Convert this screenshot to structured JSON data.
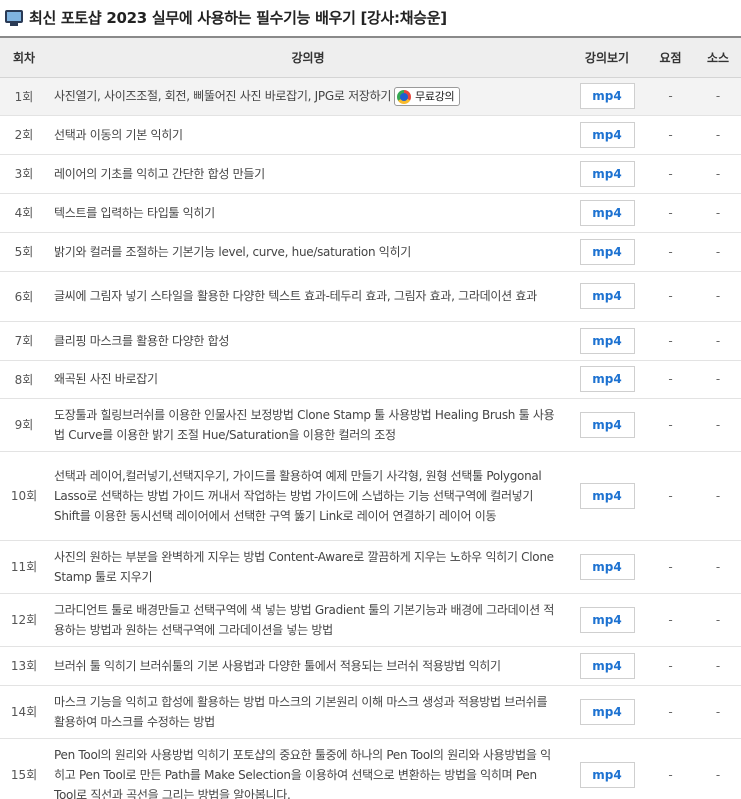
{
  "page": {
    "title": "최신 포토샵 2023 실무에 사용하는 필수기능 배우기 [강사:채승운]",
    "icon": "monitor-icon"
  },
  "table": {
    "headers": {
      "num": "회차",
      "title": "강의명",
      "view": "강의보기",
      "summary": "요점",
      "source": "소스"
    },
    "free_badge": "무료강의",
    "rows": [
      {
        "num": "1회",
        "title": "사진열기, 사이즈조절, 회전, 삐뚤어진 사진 바로잡기, JPG로 저장하기",
        "view": "mp4",
        "summary": "-",
        "source": "-",
        "free": true
      },
      {
        "num": "2회",
        "title": "선택과 이동의 기본 익히기",
        "view": "mp4",
        "summary": "-",
        "source": "-"
      },
      {
        "num": "3회",
        "title": "레이어의 기초를 익히고 간단한 합성 만들기",
        "view": "mp4",
        "summary": "-",
        "source": "-"
      },
      {
        "num": "4회",
        "title": "텍스트를 입력하는 타입툴 익히기",
        "view": "mp4",
        "summary": "-",
        "source": "-"
      },
      {
        "num": "5회",
        "title": "밝기와 컬러를 조절하는 기본기능 level, curve, hue/saturation 익히기",
        "view": "mp4",
        "summary": "-",
        "source": "-"
      },
      {
        "num": "6회",
        "title": "글씨에 그림자 넣기 스타일을 활용한 다양한 텍스트 효과-테두리 효과, 그림자 효과, 그라데이션 효과",
        "view": "mp4",
        "summary": "-",
        "source": "-"
      },
      {
        "num": "7회",
        "title": "클리핑 마스크를 활용한 다양한 합성",
        "view": "mp4",
        "summary": "-",
        "source": "-"
      },
      {
        "num": "8회",
        "title": "왜곡된 사진 바로잡기",
        "view": "mp4",
        "summary": "-",
        "source": "-"
      },
      {
        "num": "9회",
        "title": "도장툴과 힐링브러쉬를 이용한 인물사진 보정방법 Clone Stamp 툴 사용방법 Healing Brush 툴 사용법 Curve를 이용한 밝기 조절 Hue/Saturation을 이용한 컬러의 조정",
        "view": "mp4",
        "summary": "-",
        "source": "-"
      },
      {
        "num": "10회",
        "title": "선택과 레이어,컬러넣기,선택지우기, 가이드를 활용하여 예제 만들기 사각형, 원형 선택툴 Polygonal Lasso로 선택하는 방법 가이드 꺼내서 작업하는 방법 가이드에 스냅하는 기능 선택구역에 컬러넣기 Shift를 이용한 동시선택 레이어에서 선택한 구역 뚫기 Link로 레이어 연결하기 레이어 이동",
        "view": "mp4",
        "summary": "-",
        "source": "-"
      },
      {
        "num": "11회",
        "title": "사진의 원하는 부분을 완벽하게 지우는 방법 Content-Aware로 깔끔하게 지우는 노하우 익히기 Clone Stamp 툴로 지우기",
        "view": "mp4",
        "summary": "-",
        "source": "-"
      },
      {
        "num": "12회",
        "title": "그라디언트 툴로 배경만들고 선택구역에 색 넣는 방법 Gradient 툴의 기본기능과 배경에 그라데이션 적용하는 방법과 원하는 선택구역에 그라데이션을 넣는 방법",
        "view": "mp4",
        "summary": "-",
        "source": "-"
      },
      {
        "num": "13회",
        "title": "브러쉬 툴 익히기 브러쉬툴의 기본 사용법과 다양한 툴에서 적용되는 브러쉬 적용방법 익히기",
        "view": "mp4",
        "summary": "-",
        "source": "-"
      },
      {
        "num": "14회",
        "title": "마스크 기능을 익히고 합성에 활용하는 방법 마스크의 기본원리 이해 마스크 생성과 적용방법 브러쉬를 활용하여 마스크를 수정하는 방법",
        "view": "mp4",
        "summary": "-",
        "source": "-"
      },
      {
        "num": "15회",
        "title": "Pen Tool의 원리와 사용방법 익히기 포토샵의 중요한 툴중에 하나의 Pen Tool의 원리와 사용방법을 익히고 Pen Tool로 만든 Path를 Make Selection을 이용하여 선택으로 변환하는 방법을 익히며 Pen Tool로 직선과 곡선을 그리는 방법을 알아봅니다.",
        "view": "mp4",
        "summary": "-",
        "source": "-"
      }
    ]
  }
}
